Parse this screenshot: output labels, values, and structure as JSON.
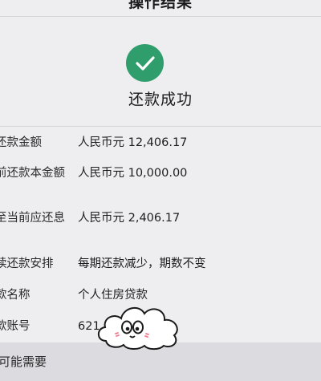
{
  "header": {
    "title": "操作结果"
  },
  "result": {
    "status_text": "还款成功",
    "icon": "check-circle-icon",
    "accent": "#2f9e6c"
  },
  "details": {
    "rows": [
      {
        "label": "还款金额",
        "value": "人民币元 12,406.17"
      },
      {
        "label": "前还款本金额",
        "value": "人民币元 10,000.00"
      },
      {
        "label": "至当前应还息",
        "value": "人民币元 2,406.17"
      },
      {
        "label": "续还款安排",
        "value": "每期还款减少，期数不变"
      },
      {
        "label": "款名称",
        "value": "个人住房贷款"
      },
      {
        "label": "款账号",
        "value": "621"
      }
    ]
  },
  "footer": {
    "section_label": "可能需要"
  },
  "overlay": {
    "sticker": "cloud-face-sticker"
  }
}
